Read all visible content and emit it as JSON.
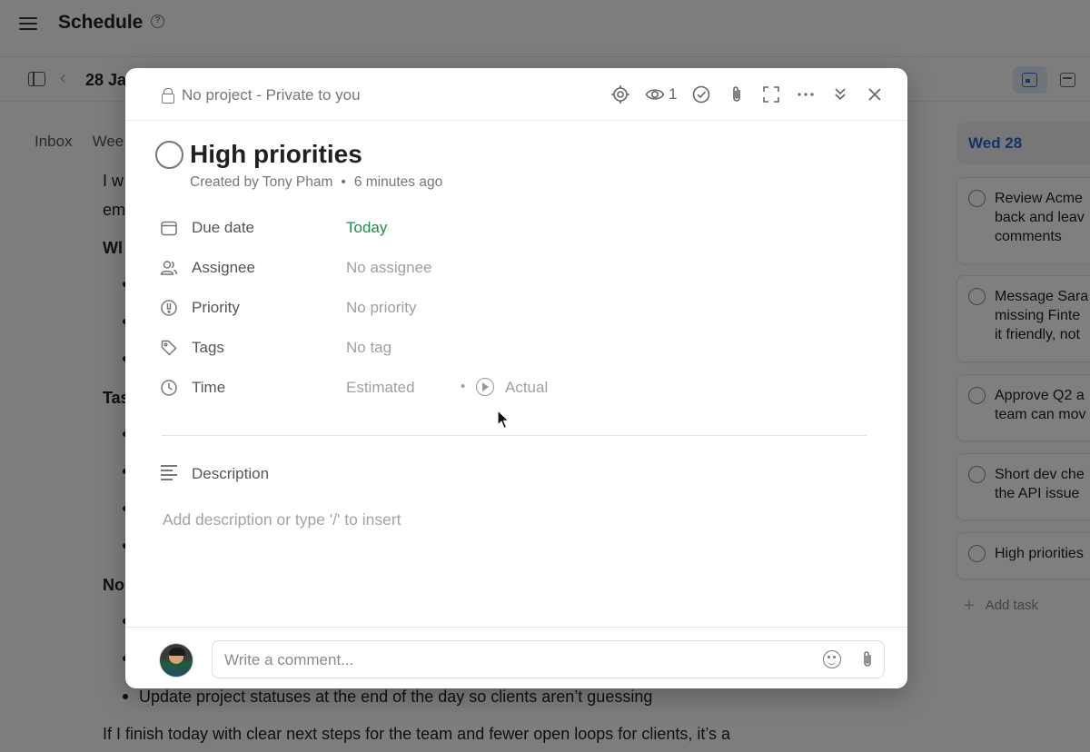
{
  "app": {
    "title": "Schedule",
    "date_label": "28 Ja",
    "tabs": [
      "Inbox",
      "Wee"
    ]
  },
  "doc": {
    "line1": "I w",
    "line2": "em",
    "heading1": "Wl",
    "heading2": "Tas",
    "heading3": "No",
    "last_bullet": "Update project statuses at the end of the day so clients aren’t guessing",
    "closing": "If I finish today with clear next steps for the team and fewer open loops for clients, it’s a"
  },
  "day_column": {
    "header": "Wed 28",
    "cards": [
      "Review Acme\nback and leav\ncomments",
      "Message Sara\nmissing Finte\nit friendly, not",
      "Approve Q2 a\nteam can mov",
      "Short dev che\nthe API issue",
      "High priorities"
    ],
    "add_task": "Add task"
  },
  "modal": {
    "project": "No project - Private to you",
    "watchers_count": "1",
    "task_title": "High priorities",
    "created_by": "Created by Tony Pham",
    "created_dot": "•",
    "created_ago": "6 minutes ago",
    "properties": {
      "due_label": "Due date",
      "due_value": "Today",
      "assignee_label": "Assignee",
      "assignee_value": "No assignee",
      "priority_label": "Priority",
      "priority_value": "No priority",
      "tags_label": "Tags",
      "tags_value": "No tag",
      "time_label": "Time",
      "time_estimated": "Estimated",
      "time_sep": "•",
      "time_actual": "Actual"
    },
    "description_label": "Description",
    "description_placeholder": "Add description or type '/' to insert",
    "comment_placeholder": "Write a comment..."
  },
  "colors": {
    "accent_blue": "#2b66c9",
    "today_green": "#1f8c4c",
    "overlay": "rgba(0,0,0,0.5)"
  },
  "icons": [
    "hamburger-icon",
    "help-icon",
    "sidebar-toggle-icon",
    "calendar-view-icon",
    "board-view-icon",
    "lock-icon",
    "location-icon",
    "eye-icon",
    "check-circle-icon",
    "paperclip-icon",
    "expand-icon",
    "more-icon",
    "collapse-icon",
    "close-icon",
    "calendar-icon",
    "people-icon",
    "priority-icon",
    "tag-icon",
    "clock-icon",
    "play-icon",
    "description-icon",
    "emoji-icon"
  ]
}
